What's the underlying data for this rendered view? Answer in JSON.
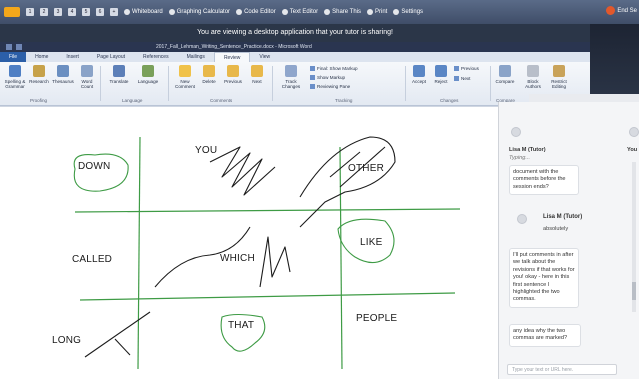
{
  "session_bar": {
    "logo_text": "TAAA",
    "pages": [
      "1",
      "2",
      "3",
      "4",
      "5",
      "6"
    ],
    "add_page": "+",
    "tools": [
      "Whiteboard",
      "Graphing Calculator",
      "Code Editor",
      "Text Editor",
      "Share This",
      "Print",
      "Settings"
    ],
    "end_label": "End Se"
  },
  "banner_text": "You are viewing a desktop application that your tutor is sharing!",
  "word": {
    "title": "2017_Fall_Lehman_Writing_Sentence_Practice.docx - Microsoft Word",
    "tabs": [
      "File",
      "Home",
      "Insert",
      "Page Layout",
      "References",
      "Mailings",
      "Review",
      "View"
    ],
    "active_tab": "Review",
    "ribbon_buttons": [
      "Spelling & Grammar",
      "Research",
      "Thesaurus",
      "Word Count",
      "Translate",
      "Language",
      "New Comment",
      "Delete",
      "Previous",
      "Next",
      "Track Changes",
      "Accept",
      "Reject",
      "Compare",
      "Block Authors",
      "Restrict Editing"
    ],
    "ribbon_small": [
      "Final: Show Markup",
      "Show Markup",
      "Reviewing Pane",
      "Previous",
      "Next"
    ],
    "group_labels": [
      "Proofing",
      "Language",
      "Comments",
      "Tracking",
      "Changes",
      "Compare"
    ]
  },
  "document_words": [
    "DOWN",
    "YOU",
    "OTHER",
    "CALLED",
    "WHICH",
    "LIKE",
    "LONG",
    "THAT",
    "PEOPLE"
  ],
  "chat": {
    "header_name": "Lisa M (Tutor)",
    "header_status": "Typing...",
    "msg1": "document with the comments before the session ends?",
    "tutor_name": "Lisa M (Tutor)",
    "tutor_status": "absolutely",
    "msg2": "I'll put comments in after we talk about the revisions if that works for you! okay - here in this first sentence I highlighted the two commas.",
    "msg3": "any idea why the two commas are marked?",
    "input_placeholder": "Type your text or URL here.",
    "side_label": "You"
  }
}
